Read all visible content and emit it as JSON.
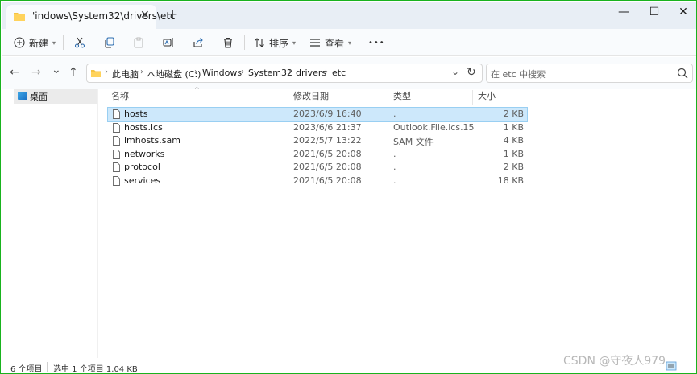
{
  "tab": {
    "title": "'indows\\System32\\drivers\\etc",
    "close": "✕"
  },
  "titlebar": {
    "new_tab": "+",
    "minimize": "—",
    "maximize": "☐",
    "close": "✕"
  },
  "toolbar": {
    "new_label": "新建",
    "sort_label": "排序",
    "view_label": "查看",
    "more": "•••",
    "chevron": "▾"
  },
  "nav": {
    "back": "←",
    "forward": "→",
    "recent": "⌄",
    "up": "↑",
    "refresh": "↻"
  },
  "address": {
    "crumbs": [
      "此电脑",
      "本地磁盘 (C:)",
      "Windows",
      "System32",
      "drivers",
      "etc"
    ],
    "sep": "›",
    "dropdown": "⌄"
  },
  "search": {
    "placeholder": "在 etc 中搜索"
  },
  "navpane": {
    "desktop_label": "桌面"
  },
  "columns": {
    "name": "名称",
    "date": "修改日期",
    "type": "类型",
    "size": "大小",
    "sort_indicator": "^"
  },
  "files": [
    {
      "name": "hosts",
      "date": "2023/6/9 16:40",
      "type": ".",
      "size": "2 KB",
      "selected": true
    },
    {
      "name": "hosts.ics",
      "date": "2023/6/6 21:37",
      "type": "Outlook.File.ics.15",
      "size": "1 KB",
      "selected": false
    },
    {
      "name": "lmhosts.sam",
      "date": "2022/5/7 13:22",
      "type": "SAM 文件",
      "size": "4 KB",
      "selected": false
    },
    {
      "name": "networks",
      "date": "2021/6/5 20:08",
      "type": ".",
      "size": "1 KB",
      "selected": false
    },
    {
      "name": "protocol",
      "date": "2021/6/5 20:08",
      "type": ".",
      "size": "2 KB",
      "selected": false
    },
    {
      "name": "services",
      "date": "2021/6/5 20:08",
      "type": ".",
      "size": "18 KB",
      "selected": false
    }
  ],
  "status": {
    "count": "6 个项目",
    "selected": "选中 1 个项目  1.04 KB"
  },
  "watermark": "CSDN @守夜人979",
  "colors": {
    "frame": "#19b31e",
    "folder": "#f4c343",
    "selection": "#cde8fb"
  }
}
